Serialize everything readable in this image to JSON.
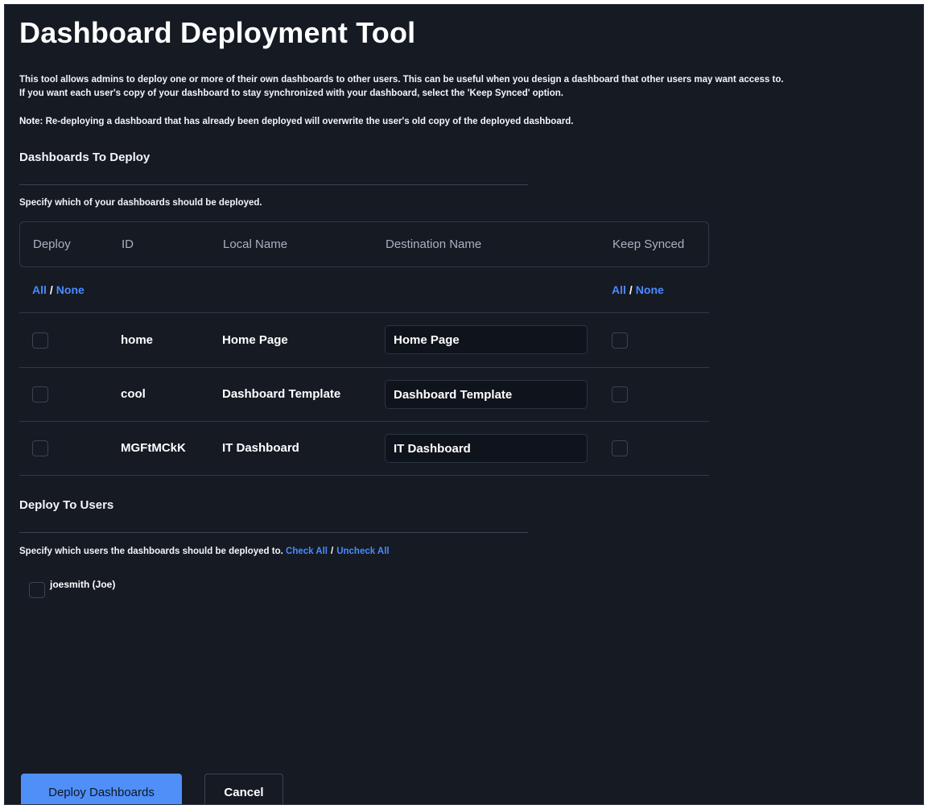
{
  "page": {
    "title": "Dashboard Deployment Tool",
    "intro_line1": "This tool allows admins to deploy one or more of their own dashboards to other users. This can be useful when you design a dashboard that other users may want access to.",
    "intro_line2": "If you want each user's copy of your dashboard to stay synchronized with your dashboard, select the 'Keep Synced' option.",
    "note_label": "Note:",
    "note_text": "Re-deploying a dashboard that has already been deployed will overwrite the user's old copy of the deployed dashboard."
  },
  "dashboards_section": {
    "title": "Dashboards To Deploy",
    "helper": "Specify which of your dashboards should be deployed.",
    "columns": {
      "deploy": "Deploy",
      "id": "ID",
      "local_name": "Local Name",
      "destination_name": "Destination Name",
      "keep_synced": "Keep Synced"
    },
    "deploy_select": {
      "all": "All",
      "separator": "/",
      "none": "None"
    },
    "synced_select": {
      "all": "All",
      "separator": "/",
      "none": "None"
    },
    "rows": [
      {
        "id": "home",
        "local_name": "Home Page",
        "destination_name": "Home Page",
        "deploy": false,
        "keep_synced": false
      },
      {
        "id": "cool",
        "local_name": "Dashboard Template",
        "destination_name": "Dashboard Template",
        "deploy": false,
        "keep_synced": false
      },
      {
        "id": "MGFtMCkK",
        "local_name": "IT Dashboard",
        "destination_name": "IT Dashboard",
        "deploy": false,
        "keep_synced": false
      }
    ]
  },
  "users_section": {
    "title": "Deploy To Users",
    "helper": "Specify which users the dashboards should be deployed to.",
    "check_all": "Check All",
    "separator": "/",
    "uncheck_all": "Uncheck All",
    "users": [
      {
        "label": "joesmith (Joe)",
        "checked": false
      }
    ]
  },
  "actions": {
    "deploy_label": "Deploy Dashboards",
    "cancel_label": "Cancel"
  },
  "colors": {
    "background": "#151a23",
    "link": "#4a8bff",
    "primary_button": "#4f8ff7"
  }
}
